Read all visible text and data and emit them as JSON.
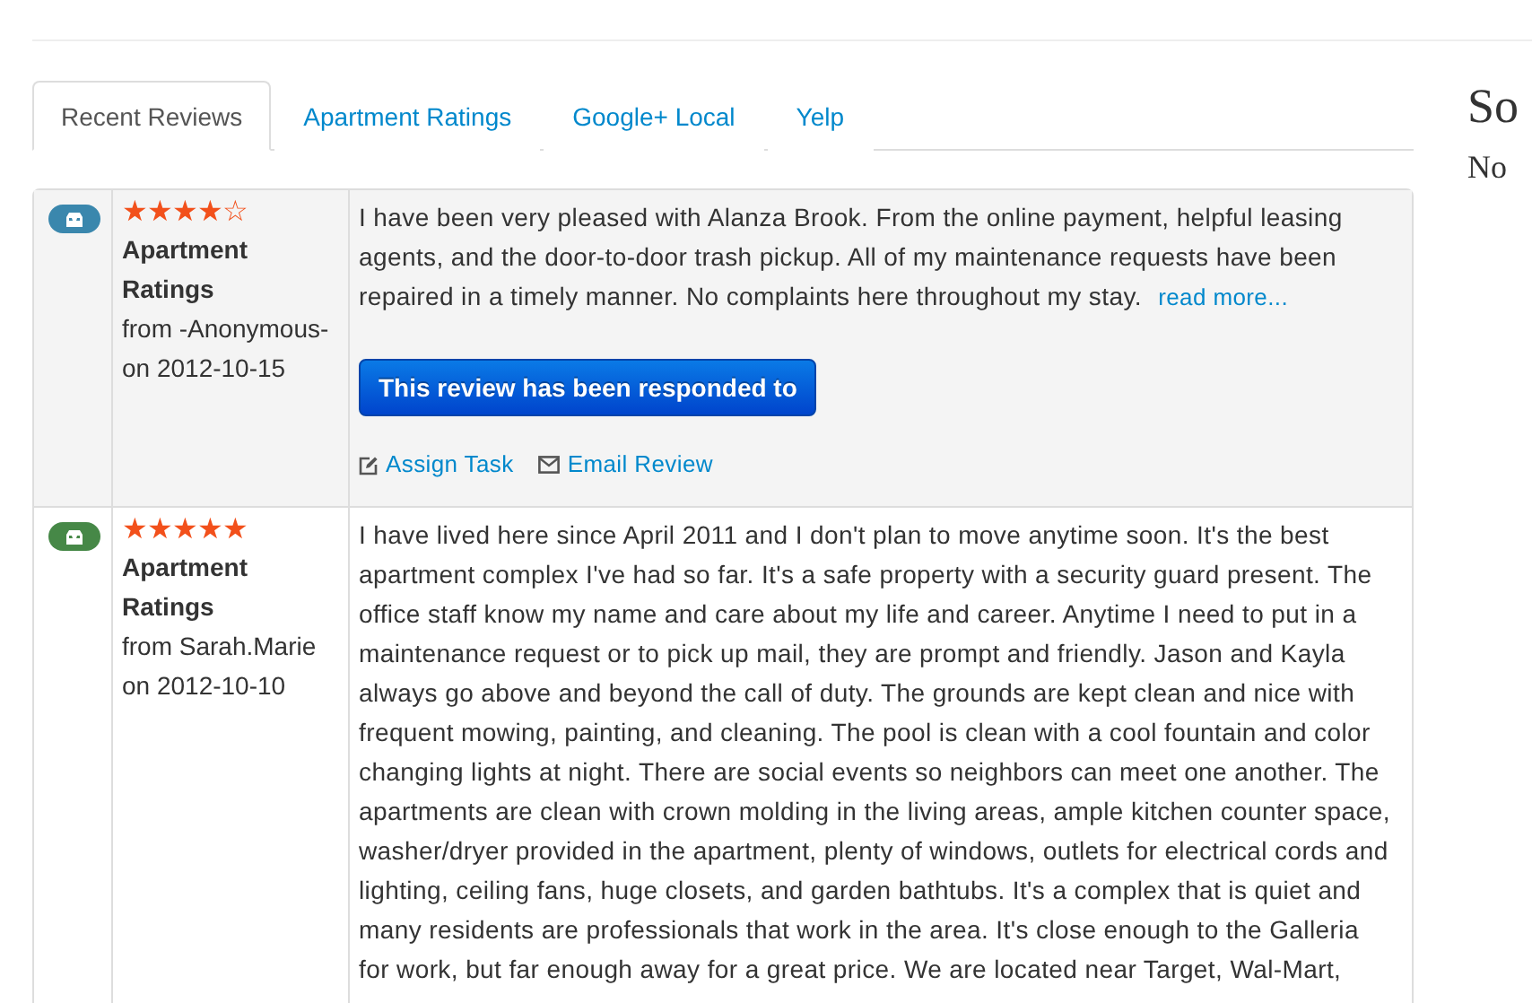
{
  "tabs": [
    {
      "label": "Recent Reviews",
      "selected": true
    },
    {
      "label": "Apartment Ratings",
      "selected": false
    },
    {
      "label": "Google+ Local",
      "selected": false
    },
    {
      "label": "Yelp",
      "selected": false
    }
  ],
  "reviews": [
    {
      "color": "#3a87ad",
      "stars": 4,
      "source": "Apartment Ratings",
      "author": "from -Anonymous-",
      "date": "on 2012-10-15",
      "text": "I have been very pleased with Alanza Brook. From the online payment, helpful leasing agents, and the door-to-door trash pickup. All of my maintenance requests have been repaired in a timely manner. No complaints here throughout my stay.",
      "read_more": "read more...",
      "response_button": "This review has been responded to",
      "actions": [
        {
          "kind": "task",
          "label": "Assign Task"
        },
        {
          "kind": "email",
          "label": "Email Review"
        }
      ]
    },
    {
      "color": "#468847",
      "stars": 5,
      "source": "Apartment Ratings",
      "author": "from Sarah.Marie",
      "date": "on 2012-10-10",
      "text": "I have lived here since April 2011 and I don't plan to move anytime soon. It's the best apartment complex I've had so far. It's a safe property with a security guard present. The office staff know my name and care about my life and career. Anytime I need to put in a maintenance request or to pick up mail, they are prompt and friendly. Jason and Kayla always go above and beyond the call of duty. The grounds are kept clean and nice with frequent mowing, painting, and cleaning. The pool is clean with a cool fountain and color changing lights at night. There are social events so neighbors can meet one another. The apartments are clean with crown molding in the living areas, ample kitchen counter space, washer/dryer provided in the apartment, plenty of windows, outlets for electrical cords and lighting, ceiling fans, huge closets, and garden bathtubs. It's a complex that is quiet and many residents are professionals that work in the area. It's close enough to the Galleria for work, but far enough away for a great price. We are located near Target, Wal-Mart,"
    }
  ],
  "sidebar": {
    "title": "So",
    "text": "No"
  }
}
